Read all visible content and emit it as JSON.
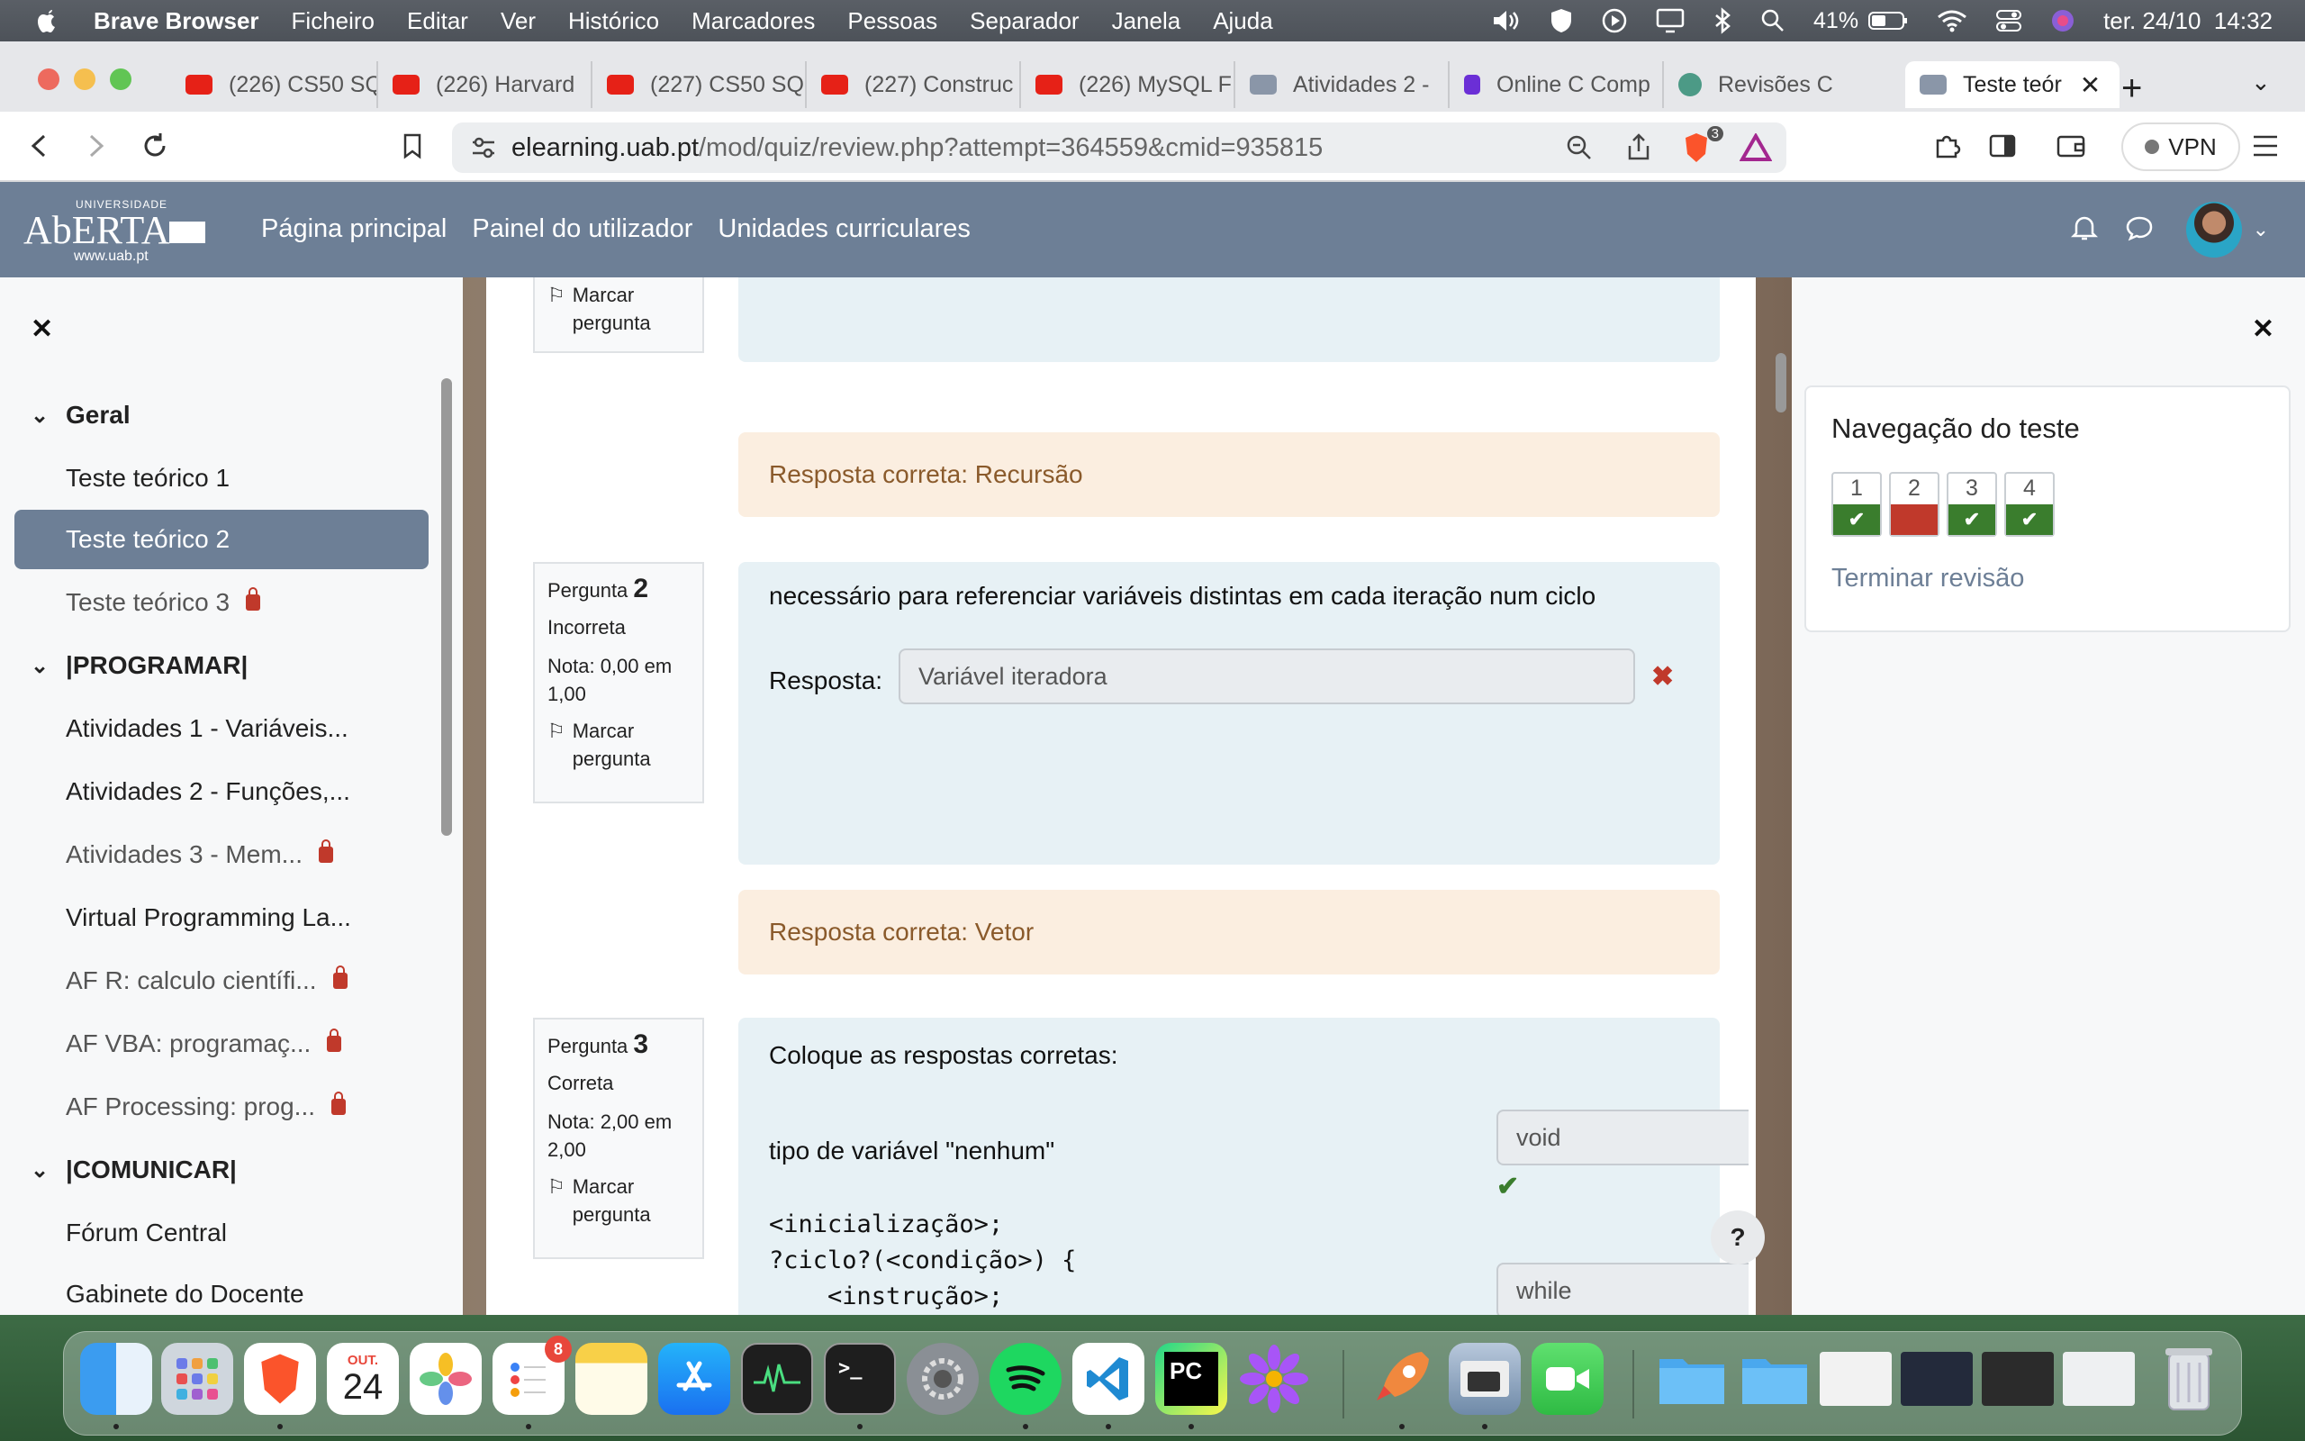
{
  "menubar": {
    "app": "Brave Browser",
    "items": [
      "Ficheiro",
      "Editar",
      "Ver",
      "Histórico",
      "Marcadores",
      "Pessoas",
      "Separador",
      "Janela",
      "Ajuda"
    ],
    "battery": "41%",
    "datetime": "ter. 24/10  14:32"
  },
  "browser": {
    "tabs": [
      {
        "label": "(226) CS50 SQ",
        "icon": "youtube-icon"
      },
      {
        "label": "(226) Harvard",
        "icon": "youtube-icon"
      },
      {
        "label": "(227) CS50 SQ",
        "icon": "youtube-icon"
      },
      {
        "label": "(227) Construc",
        "icon": "youtube-icon"
      },
      {
        "label": "(226) MySQL F",
        "icon": "youtube-icon"
      },
      {
        "label": "Atividades 2 -",
        "icon": "laptop-icon"
      },
      {
        "label": "Online C Comp",
        "icon": "p-icon"
      },
      {
        "label": "Revisões C",
        "icon": "chatgpt-icon"
      },
      {
        "label": "Teste teór",
        "icon": "laptop-icon",
        "active": true
      }
    ],
    "url_host": "elearning.uab.pt",
    "url_path": "/mod/quiz/review.php?attempt=364559&cmid=935815",
    "brave_badge": "3",
    "vpn_label": "VPN"
  },
  "site": {
    "logo": {
      "small": "UNIVERSIDADE",
      "big": "AbERTA",
      "www": "www.uab.pt"
    },
    "nav": [
      "Página principal",
      "Painel do utilizador",
      "Unidades curriculares"
    ]
  },
  "drawer": {
    "items": [
      {
        "label": "Geral",
        "type": "section"
      },
      {
        "label": "Teste teórico 1",
        "type": "item"
      },
      {
        "label": "Teste teórico 2",
        "type": "item",
        "active": true
      },
      {
        "label": "Teste teórico 3",
        "type": "item",
        "locked": true
      },
      {
        "label": "|PROGRAMAR|",
        "type": "section"
      },
      {
        "label": "Atividades 1 - Variáveis...",
        "type": "item"
      },
      {
        "label": "Atividades 2 - Funções,...",
        "type": "item"
      },
      {
        "label": "Atividades 3 - Mem...",
        "type": "item",
        "locked": true
      },
      {
        "label": "Virtual Programming La...",
        "type": "item"
      },
      {
        "label": "AF R: calculo científi...",
        "type": "item",
        "locked": true
      },
      {
        "label": "AF VBA: programaç...",
        "type": "item",
        "locked": true
      },
      {
        "label": "AF Processing: prog...",
        "type": "item",
        "locked": true
      },
      {
        "label": "|COMUNICAR|",
        "type": "section"
      },
      {
        "label": "Fórum Central",
        "type": "item"
      },
      {
        "label": "Gabinete do Docente",
        "type": "item"
      }
    ]
  },
  "quiz": {
    "q1": {
      "flag_label": "Marcar pergunta",
      "correct_answer": "Resposta correta: Recursão"
    },
    "q2": {
      "label": "Pergunta",
      "number": "2",
      "state": "Incorreta",
      "grade": "Nota: 0,00 em 1,00",
      "flag_label": "Marcar pergunta",
      "text": "necessário para referenciar variáveis distintas em cada iteração num ciclo",
      "answer_label": "Resposta:",
      "answer_value": "Variável iteradora",
      "correct_answer": "Resposta correta: Vetor"
    },
    "q3": {
      "label": "Pergunta",
      "number": "3",
      "state": "Correta",
      "grade": "Nota: 2,00 em 2,00",
      "flag_label": "Marcar pergunta",
      "text": "Coloque as respostas corretas:",
      "prompt1": "tipo de variável \"nenhum\"",
      "answer1": "void",
      "code_lines": [
        "<inicialização>;",
        "?ciclo?(<condição>) {",
        "    <instrução>;"
      ],
      "answer2": "while"
    },
    "help": "?"
  },
  "quiznav": {
    "title": "Navegação do teste",
    "questions": [
      {
        "n": "1",
        "status": "correct"
      },
      {
        "n": "2",
        "status": "incorrect"
      },
      {
        "n": "3",
        "status": "correct"
      },
      {
        "n": "4",
        "status": "correct"
      }
    ],
    "finish": "Terminar revisão"
  },
  "dock": {
    "calendar_month": "OUT.",
    "calendar_day": "24",
    "reminders_badge": "8"
  },
  "colors": {
    "header": "#6d7f96",
    "correct": "#3a7d2d",
    "incorrect": "#c0392b",
    "answer_bg": "#fbeee0",
    "question_bg": "#e7f1f5"
  }
}
